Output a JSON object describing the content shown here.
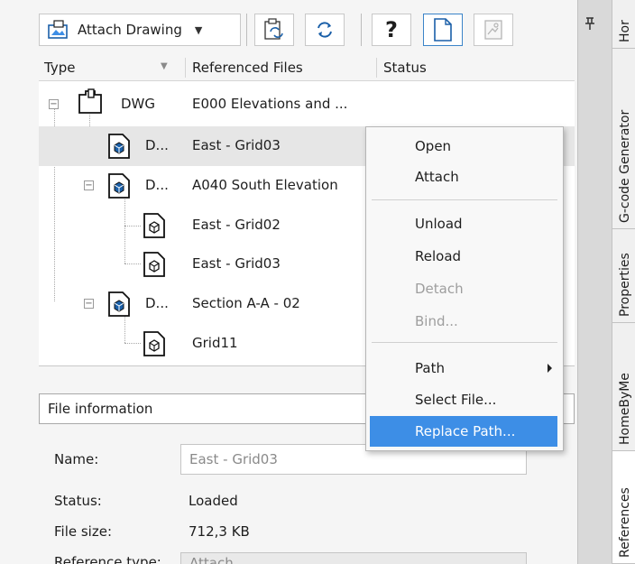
{
  "toolbar": {
    "attach_label": "Attach Drawing",
    "help_label": "?"
  },
  "tree": {
    "columns": [
      "Type",
      "Referenced Files",
      "Status"
    ],
    "rows": [
      {
        "name": "DWG",
        "file": "E000 Elevations and ..."
      },
      {
        "name": "D...",
        "file": "East - Grid03"
      },
      {
        "name": "D...",
        "file": "A040 South Elevation"
      },
      {
        "name": "",
        "file": "East - Grid02"
      },
      {
        "name": "",
        "file": "East - Grid03"
      },
      {
        "name": "D...",
        "file": "Section A-A - 02"
      },
      {
        "name": "",
        "file": "Grid11"
      }
    ]
  },
  "file_info": {
    "header": "File information",
    "name_label": "Name:",
    "name_value": "East - Grid03",
    "status_label": "Status:",
    "status_value": "Loaded",
    "size_label": "File size:",
    "size_value": "712,3 KB",
    "ref_label": "Reference type:",
    "ref_value": "Attach"
  },
  "context_menu": {
    "items": [
      "Open",
      "Attach",
      "Unload",
      "Reload",
      "Detach",
      "Bind...",
      "Path",
      "Select File...",
      "Replace Path..."
    ],
    "disabled": [
      "Detach",
      "Bind..."
    ],
    "highlighted": "Replace Path..."
  },
  "side_tabs": [
    "Hor",
    "G-code Generator",
    "Properties",
    "HomeByMe",
    "References"
  ],
  "colors": {
    "highlight": "#3d8ee6",
    "selection": "#e6e6e6",
    "active_border": "#3b84c8"
  },
  "icons": [
    "attach-drawing-icon",
    "chevron-down-icon",
    "attach-reference-icon",
    "refresh-references-icon",
    "help-icon",
    "tree-view-icon",
    "preview-view-icon",
    "pin-icon",
    "dwg-folder-icon",
    "dwg-file-icon",
    "submenu-arrow-icon"
  ]
}
